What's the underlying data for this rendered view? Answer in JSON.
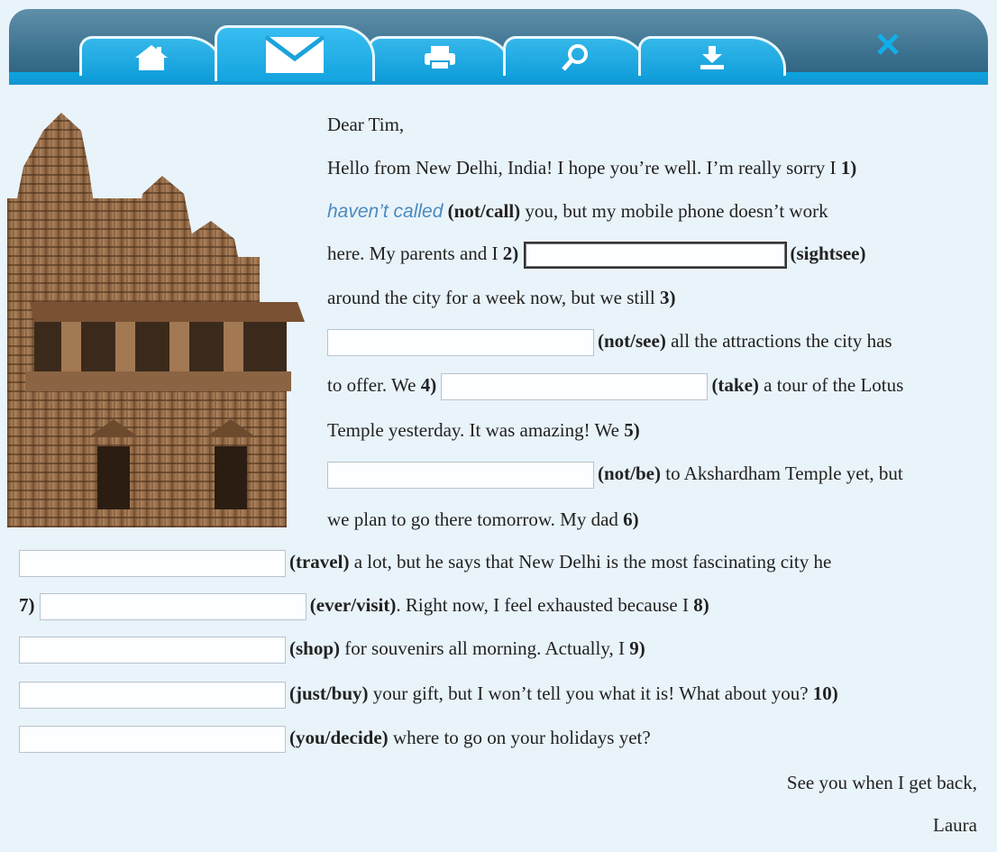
{
  "toolbar": {
    "tabs": [
      {
        "icon": "home-icon",
        "active": false
      },
      {
        "icon": "mail-icon",
        "active": true
      },
      {
        "icon": "print-icon",
        "active": false
      },
      {
        "icon": "search-icon",
        "active": false
      },
      {
        "icon": "download-icon",
        "active": false
      }
    ],
    "close_icon": "close-icon",
    "accent_color": "#13a0dc",
    "bar_color": "#3e7390"
  },
  "letter": {
    "greeting": "Dear Tim,",
    "line1": "Hello from New Delhi, India! I hope you’re well. I’m really sorry I ",
    "n1": "1)",
    "answer1": "haven’t called",
    "verb1": "(not/call)",
    "line2_rest": " you, but my mobile phone doesn’t work",
    "line3_pre": "here. My parents and I ",
    "n2": "2)",
    "verb2": "(sightsee)",
    "line4": "around the city for a week now, but we still ",
    "n3": "3)",
    "verb3": "(not/see)",
    "line5_rest": " all the attractions the city has",
    "line6_pre": "to offer. We ",
    "n4": "4)",
    "verb4": "(take)",
    "line6_rest": " a tour of the Lotus",
    "line7": "Temple yesterday. It was amazing! We ",
    "n5": "5)",
    "verb5": "(not/be)",
    "line8_rest": " to Akshardham Temple yet, but",
    "line9": "we plan to go there tomorrow. My dad ",
    "n6": "6)",
    "verb6": "(travel)",
    "line10_rest": " a lot, but he says that New Delhi is the most fascinating city he",
    "n7": "7)",
    "verb7": "(ever/visit)",
    "line11_rest": ". Right now, I feel exhausted because I ",
    "n8": "8)",
    "verb8": "(shop)",
    "line12_rest": " for souvenirs all morning. Actually, I ",
    "n9": "9)",
    "verb9": "(just/buy)",
    "line13_rest": " your gift, but I won’t tell you what it is! What about you? ",
    "n10": "10)",
    "verb10": "(you/decide)",
    "line14_rest": " where to go on your holidays yet?",
    "closing": "See you when I get back,",
    "signature": "Laura"
  },
  "image": {
    "subject": "temple-photo"
  }
}
